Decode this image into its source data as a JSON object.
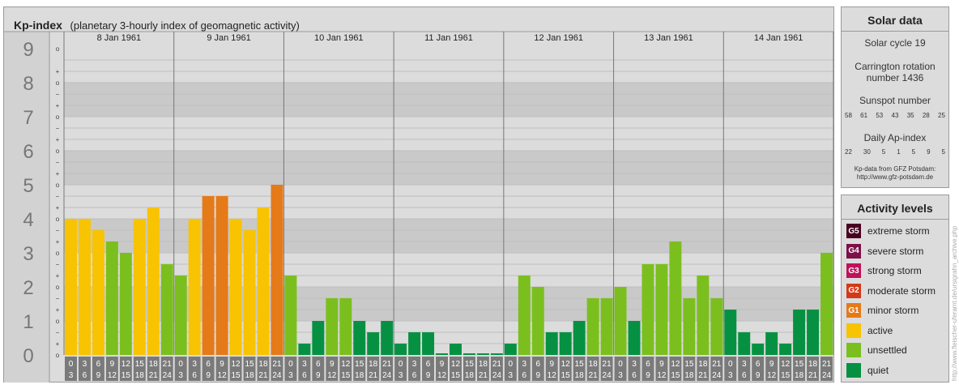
{
  "header": {
    "title": "Kp-index",
    "subtitle": "(planetary 3-hourly index of geomagnetic activity)"
  },
  "chart_data": {
    "type": "bar",
    "title": "Kp-index",
    "subtitle": "(planetary 3-hourly index of geomagnetic activity)",
    "ylim": [
      0,
      9
    ],
    "y_ticks": [
      "0",
      "1",
      "2",
      "3",
      "4",
      "5",
      "6",
      "7",
      "8",
      "9"
    ],
    "y_minor_ticks": [
      "o",
      "+",
      "−"
    ],
    "days": [
      "8 Jan 1961",
      "9 Jan 1961",
      "10 Jan 1961",
      "11 Jan 1961",
      "12 Jan 1961",
      "13 Jan 1961",
      "14 Jan 1961"
    ],
    "interval_start_labels": [
      "0",
      "3",
      "6",
      "9",
      "12",
      "15",
      "18",
      "21"
    ],
    "interval_end_labels": [
      "3",
      "6",
      "9",
      "12",
      "15",
      "18",
      "21",
      "24"
    ],
    "values": [
      [
        4.0,
        4.0,
        3.667,
        3.333,
        3.0,
        4.0,
        4.333,
        2.667
      ],
      [
        2.333,
        4.0,
        4.667,
        4.667,
        4.0,
        3.667,
        4.333,
        5.0
      ],
      [
        2.333,
        0.333,
        1.0,
        1.667,
        1.667,
        1.0,
        0.667,
        1.0
      ],
      [
        0.333,
        0.667,
        0.667,
        0.0,
        0.333,
        0.0,
        0.0,
        0.0
      ],
      [
        0.333,
        2.333,
        2.0,
        0.667,
        0.667,
        1.0,
        1.667,
        1.667
      ],
      [
        2.0,
        1.0,
        2.667,
        2.667,
        3.333,
        1.667,
        2.333,
        1.667
      ],
      [
        1.333,
        0.667,
        0.333,
        0.667,
        0.333,
        1.333,
        1.333,
        3.0
      ]
    ],
    "levels": [
      [
        "active",
        "active",
        "active",
        "unsettled",
        "unsettled",
        "active",
        "active",
        "unsettled"
      ],
      [
        "unsettled",
        "active",
        "minor storm",
        "minor storm",
        "active",
        "active",
        "active",
        "minor storm"
      ],
      [
        "unsettled",
        "quiet",
        "quiet",
        "unsettled",
        "unsettled",
        "quiet",
        "quiet",
        "quiet"
      ],
      [
        "quiet",
        "quiet",
        "quiet",
        "quiet",
        "quiet",
        "quiet",
        "quiet",
        "quiet"
      ],
      [
        "quiet",
        "unsettled",
        "unsettled",
        "quiet",
        "quiet",
        "quiet",
        "unsettled",
        "unsettled"
      ],
      [
        "unsettled",
        "quiet",
        "unsettled",
        "unsettled",
        "unsettled",
        "unsettled",
        "unsettled",
        "unsettled"
      ],
      [
        "quiet",
        "quiet",
        "quiet",
        "quiet",
        "quiet",
        "quiet",
        "quiet",
        "unsettled"
      ]
    ],
    "level_colors": {
      "quiet": "#069142",
      "unsettled": "#7bbf1e",
      "active": "#f8c300",
      "minor storm": "#e57a18",
      "moderate storm": "#d33a17",
      "strong storm": "#bf1259",
      "severe storm": "#7d1048",
      "extreme storm": "#4a0021"
    }
  },
  "solar_data": {
    "title": "Solar data",
    "solar_cycle": "Solar cycle 19",
    "carrington_line1": "Carrington rotation",
    "carrington_line2": "number 1436",
    "sunspot_title": "Sunspot number",
    "sunspot_values": [
      "58",
      "61",
      "53",
      "43",
      "35",
      "28",
      "25"
    ],
    "ap_title": "Daily Ap-index",
    "ap_values": [
      "22",
      "30",
      "5",
      "1",
      "5",
      "9",
      "5"
    ],
    "source_line1": "Kp-data from GFZ Potsdam:",
    "source_line2": "http://www.gfz-potsdam.de"
  },
  "activity_levels": {
    "title": "Activity levels",
    "items": [
      {
        "badge": "G5",
        "label": "extreme storm",
        "color": "#4a0021"
      },
      {
        "badge": "G4",
        "label": "severe storm",
        "color": "#7d1048"
      },
      {
        "badge": "G3",
        "label": "strong storm",
        "color": "#bf1259"
      },
      {
        "badge": "G2",
        "label": "moderate storm",
        "color": "#d33a17"
      },
      {
        "badge": "G1",
        "label": "minor storm",
        "color": "#e57a18"
      },
      {
        "badge": "",
        "label": "active",
        "color": "#f8c300"
      },
      {
        "badge": "",
        "label": "unsettled",
        "color": "#7bbf1e"
      },
      {
        "badge": "",
        "label": "quiet",
        "color": "#069142"
      }
    ]
  },
  "credit": "http://www.fleischer-uferamt.de/ursigrahn_archive.php"
}
